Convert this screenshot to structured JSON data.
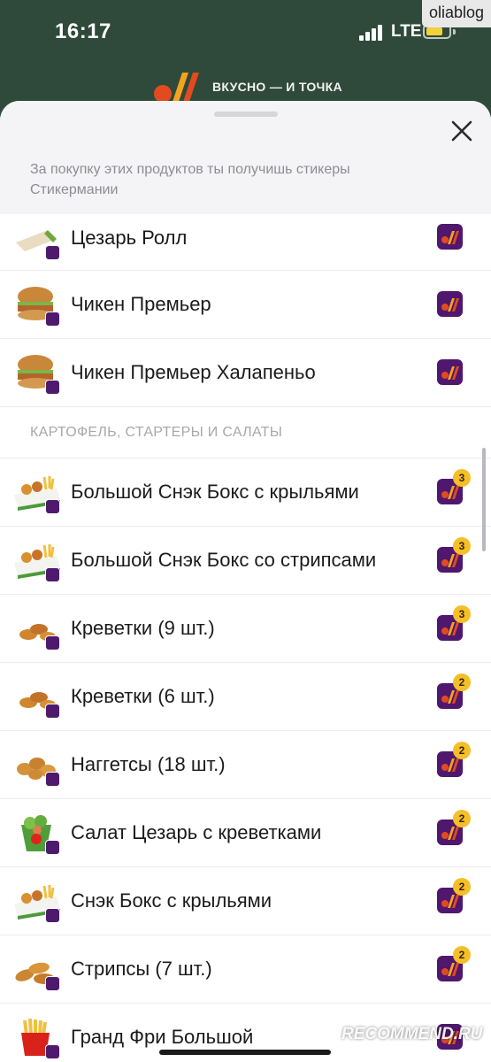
{
  "status_bar": {
    "time": "16:17",
    "network": "LTE",
    "watermark": "oliablog"
  },
  "brand": {
    "text": "ВКУСНО — И ТОЧКА"
  },
  "sheet": {
    "description": "За покупку этих продуктов ты получишь стикеры Стикермании",
    "close_icon": "close-icon"
  },
  "items_top": [
    {
      "name": "Цезарь Ролл",
      "icon": "roll"
    },
    {
      "name": "Чикен Премьер",
      "icon": "burger"
    },
    {
      "name": "Чикен Премьер Халапеньо",
      "icon": "burger"
    }
  ],
  "section": {
    "title": "КАРТОФЕЛЬ, СТАРТЕРЫ И САЛАТЫ"
  },
  "items_section": [
    {
      "name": "Большой Снэк Бокс с крыльями",
      "stickers": "3",
      "icon": "snack-box"
    },
    {
      "name": "Большой Снэк Бокс со стрипсами",
      "stickers": "3",
      "icon": "snack-box"
    },
    {
      "name": "Креветки (9 шт.)",
      "stickers": "3",
      "icon": "shrimp"
    },
    {
      "name": "Креветки (6 шт.)",
      "stickers": "2",
      "icon": "shrimp"
    },
    {
      "name": "Наггетсы (18 шт.)",
      "stickers": "2",
      "icon": "nuggets"
    },
    {
      "name": "Салат Цезарь с креветками",
      "stickers": "2",
      "icon": "salad"
    },
    {
      "name": "Снэк Бокс с крыльями",
      "stickers": "2",
      "icon": "snack-box"
    },
    {
      "name": "Стрипсы (7 шт.)",
      "stickers": "2",
      "icon": "strips"
    },
    {
      "name": "Гранд Фри Большой",
      "stickers": "",
      "icon": "fries"
    }
  ],
  "colors": {
    "header_bg": "#2f4a3a",
    "sticker_purple": "#4f176d",
    "count_yellow": "#f4bf28"
  },
  "footer": {
    "watermark": "RECOMMEND.RU"
  }
}
